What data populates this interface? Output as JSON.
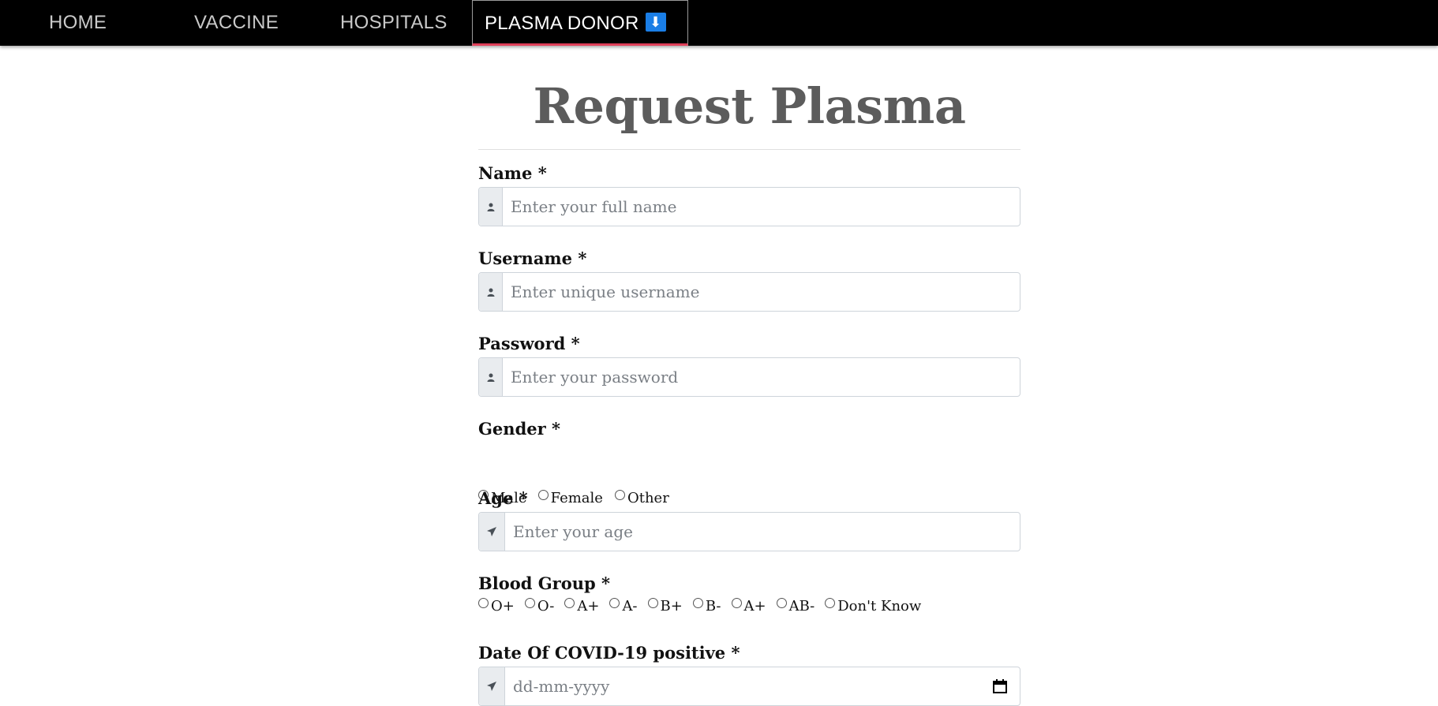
{
  "nav": {
    "items": [
      {
        "label": "HOME"
      },
      {
        "label": "VACCINE"
      },
      {
        "label": "HOSPITALS"
      },
      {
        "label": "PLASMA DONOR",
        "badge": "⬇"
      }
    ]
  },
  "form": {
    "title": "Request Plasma",
    "name": {
      "label": "Name *",
      "placeholder": "Enter your full name",
      "icon": "user-icon"
    },
    "username": {
      "label": "Username *",
      "placeholder": "Enter unique username",
      "icon": "user-icon"
    },
    "password": {
      "label": "Password *",
      "placeholder": "Enter your password",
      "icon": "user-icon"
    },
    "gender": {
      "label": "Gender *",
      "options": [
        "Male",
        "Female",
        "Other"
      ]
    },
    "age": {
      "label": "Age *",
      "placeholder": "Enter your age",
      "icon": "paper-plane-icon"
    },
    "blood_group": {
      "label": "Blood Group *",
      "options": [
        "O+",
        "O-",
        "A+",
        "A-",
        "B+",
        "B-",
        "A+",
        "AB-",
        "Don't Know"
      ]
    },
    "covid_date": {
      "label": "Date Of COVID-19 positive *",
      "placeholder": "dd-mm-yyyy",
      "icon": "paper-plane-icon"
    }
  },
  "colors": {
    "nav_bg": "#000000",
    "active_underline": "#e0405a",
    "badge_blue": "#1a7ee6",
    "title_gray": "#5c5c5c"
  }
}
